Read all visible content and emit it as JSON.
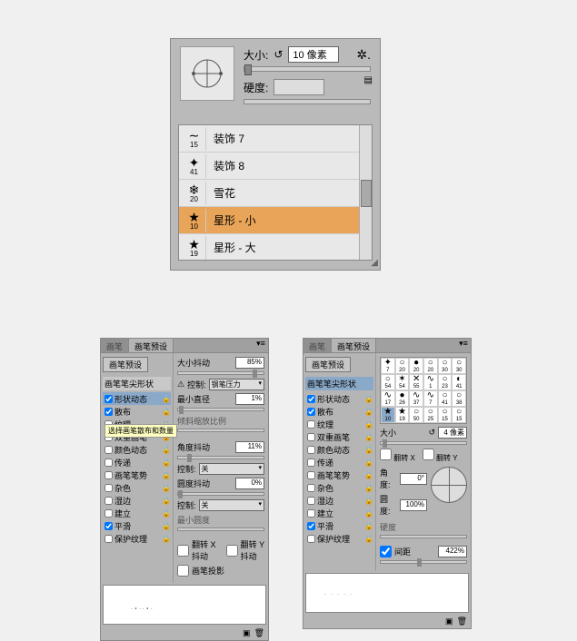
{
  "top": {
    "size_label": "大小:",
    "size_value": "10 像素",
    "hardness_label": "硬度:",
    "brushes": [
      {
        "glyph": "∼",
        "num": "15",
        "name": "装饰 7"
      },
      {
        "glyph": "✦",
        "num": "41",
        "name": "装饰 8"
      },
      {
        "glyph": "❄",
        "num": "20",
        "name": "雪花"
      },
      {
        "glyph": "★",
        "num": "10",
        "name": "星形 - 小",
        "selected": true
      },
      {
        "glyph": "★",
        "num": "19",
        "name": "星形 - 大"
      }
    ]
  },
  "leftPanel": {
    "tabs": {
      "a": "画笔",
      "b": "画笔预设"
    },
    "preset_btn": "画笔预设",
    "tip_shape": "画笔笔尖形状",
    "checks": [
      {
        "label": "形状动态",
        "checked": true,
        "hl": true
      },
      {
        "label": "散布",
        "checked": true
      },
      {
        "label": "纹理",
        "checked": false
      },
      {
        "label": "双重画笔",
        "checked": false
      },
      {
        "label": "颜色动态",
        "checked": false
      },
      {
        "label": "传递",
        "checked": false
      },
      {
        "label": "画笔笔势",
        "checked": false
      },
      {
        "label": "杂色",
        "checked": false
      },
      {
        "label": "湿边",
        "checked": false
      },
      {
        "label": "建立",
        "checked": false
      },
      {
        "label": "平滑",
        "checked": true
      },
      {
        "label": "保护纹理",
        "checked": false
      }
    ],
    "tooltip": "选择画笔散布和数量",
    "right": {
      "size_jitter": "大小抖动",
      "size_jitter_val": "85%",
      "control": "控制:",
      "control_val": "钢笔压力",
      "min_diam": "最小直径",
      "min_diam_val": "1%",
      "tilt_scale": "倾斜缩放比例",
      "angle_jitter": "角度抖动",
      "angle_jitter_val": "11%",
      "control_off": "关",
      "round_jitter": "圆度抖动",
      "round_jitter_val": "0%",
      "min_round": "最小圆度",
      "flip_x": "翻转 X 抖动",
      "flip_y": "翻转 Y 抖动",
      "brush_proj": "画笔投影"
    }
  },
  "rightPanel": {
    "tabs": {
      "a": "画笔",
      "b": "画笔预设"
    },
    "preset_btn": "画笔预设",
    "tip_shape": "画笔笔尖形状",
    "checks": [
      {
        "label": "形状动态",
        "checked": true
      },
      {
        "label": "散布",
        "checked": true
      },
      {
        "label": "纹理",
        "checked": false
      },
      {
        "label": "双重画笔",
        "checked": false
      },
      {
        "label": "颜色动态",
        "checked": false
      },
      {
        "label": "传递",
        "checked": false
      },
      {
        "label": "画笔笔势",
        "checked": false
      },
      {
        "label": "杂色",
        "checked": false
      },
      {
        "label": "湿边",
        "checked": false
      },
      {
        "label": "建立",
        "checked": false
      },
      {
        "label": "平滑",
        "checked": true
      },
      {
        "label": "保护纹理",
        "checked": false
      }
    ],
    "grid": [
      {
        "g": "✦",
        "n": "7"
      },
      {
        "g": "○",
        "n": "20"
      },
      {
        "g": "●",
        "n": "20"
      },
      {
        "g": "○",
        "n": "20"
      },
      {
        "g": "○",
        "n": "30"
      },
      {
        "g": "○",
        "n": "30"
      },
      {
        "g": "○",
        "n": "54"
      },
      {
        "g": "✶",
        "n": "54"
      },
      {
        "g": "✕",
        "n": "55"
      },
      {
        "g": "∿",
        "n": "1"
      },
      {
        "g": "○",
        "n": "23"
      },
      {
        "g": "◐",
        "n": "41"
      },
      {
        "g": "∿",
        "n": "17"
      },
      {
        "g": "●",
        "n": "26"
      },
      {
        "g": "∿",
        "n": "37"
      },
      {
        "g": "∿",
        "n": "7"
      },
      {
        "g": "○",
        "n": "41"
      },
      {
        "g": "○",
        "n": "38"
      },
      {
        "g": "★",
        "n": "10",
        "sel": true
      },
      {
        "g": "★",
        "n": "19"
      },
      {
        "g": "○",
        "n": "50"
      },
      {
        "g": "○",
        "n": "25"
      },
      {
        "g": "○",
        "n": "15"
      },
      {
        "g": "○",
        "n": "15"
      }
    ],
    "right": {
      "size": "大小",
      "size_val": "4 像素",
      "flip_x": "翻转 X",
      "flip_y": "翻转 Y",
      "angle": "角度:",
      "angle_val": "0°",
      "round": "圆度:",
      "round_val": "100%",
      "hardness": "硬度",
      "spacing": "间距",
      "spacing_val": "422%"
    }
  }
}
